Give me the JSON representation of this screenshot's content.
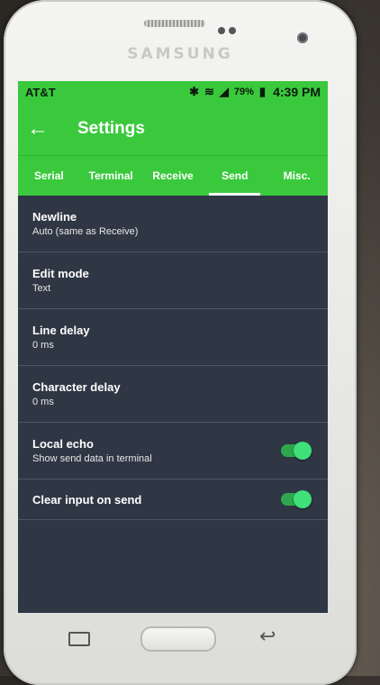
{
  "device": {
    "brand": "SAMSUNG"
  },
  "status": {
    "carrier": "AT&T",
    "battery": "79%",
    "time": "4:39 PM",
    "icons": [
      "bluetooth-icon",
      "wifi-icon",
      "signal-icon",
      "battery-icon"
    ]
  },
  "appbar": {
    "title": "Settings",
    "back_icon": "arrow-left-icon"
  },
  "tabs": [
    {
      "label": "Serial"
    },
    {
      "label": "Terminal"
    },
    {
      "label": "Receive"
    },
    {
      "label": "Send"
    },
    {
      "label": "Misc."
    }
  ],
  "active_tab": "Send",
  "settings": {
    "newline": {
      "label": "Newline",
      "value": "Auto (same as Receive)"
    },
    "edit_mode": {
      "label": "Edit mode",
      "value": "Text"
    },
    "line_delay": {
      "label": "Line delay",
      "value": "0 ms"
    },
    "char_delay": {
      "label": "Character delay",
      "value": "0 ms"
    },
    "local_echo": {
      "label": "Local echo",
      "value": "Show send data in terminal",
      "enabled": true
    },
    "clear_input": {
      "label": "Clear input on send",
      "enabled": true
    }
  },
  "colors": {
    "accent": "#3ac93d",
    "background": "#2f3644",
    "switch_on": "#3fe07a"
  }
}
